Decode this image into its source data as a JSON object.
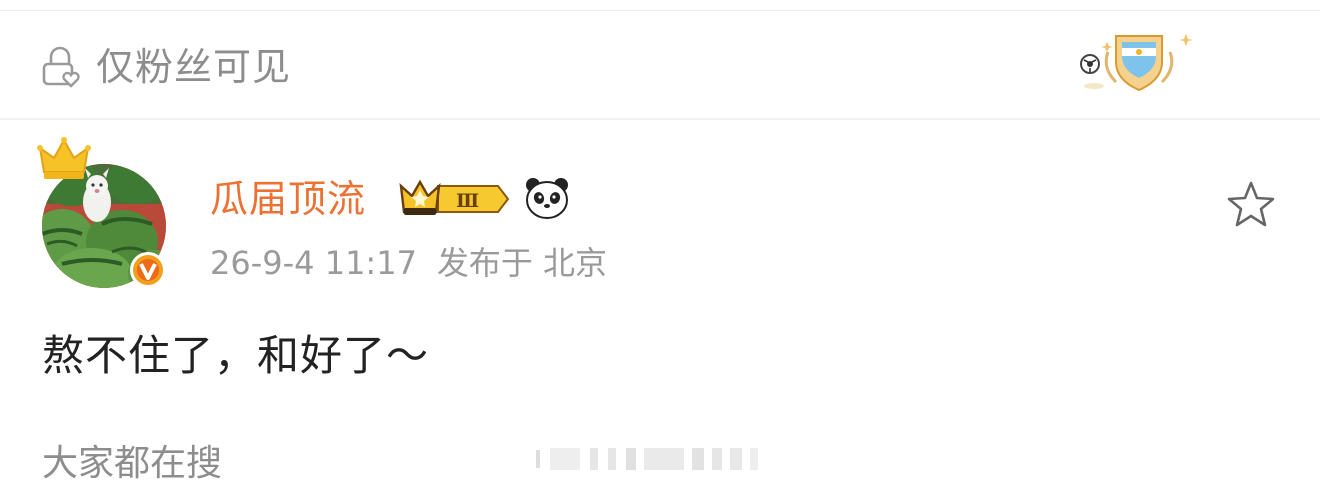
{
  "visibility": {
    "label": "仅粉丝可见",
    "icon": "lock-heart-icon",
    "badge_icon": "argentina-football-badge-icon"
  },
  "post": {
    "author": "瓜届顶流",
    "vip_level": "Ⅲ",
    "timestamp": "26-9-4 11:17",
    "location_prefix": "发布于",
    "location": "北京",
    "text": "熬不住了，和好了～",
    "icons": [
      "crown-icon",
      "verified-icon",
      "vip-crown-icon",
      "panda-icon",
      "star-icon"
    ]
  },
  "trending": {
    "label": "大家都在搜"
  },
  "colors": {
    "username": "#eb7233",
    "muted": "#9a9a9a",
    "text": "#222222",
    "accent": "#f2b320"
  }
}
